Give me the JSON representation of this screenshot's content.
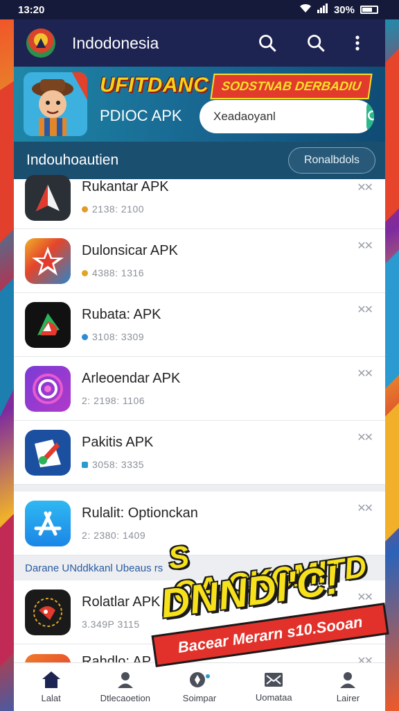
{
  "status_bar": {
    "time": "13:20",
    "battery": "30%"
  },
  "app_bar": {
    "title": "Indodonesia",
    "icons": [
      "search-icon",
      "search-icon",
      "more-vert-icon"
    ]
  },
  "banner": {
    "title": "UFITDANC",
    "tag": "SODSTNAB DERBADIU",
    "subtitle": "PDIOC APK",
    "search_value": "Xeadaoyanl"
  },
  "section": {
    "title": "Indouhoautien",
    "button": "Ronalbdols"
  },
  "list": [
    {
      "name": "Rukantar APK",
      "meta": "2138: 2100",
      "dot": "#e39a2a"
    },
    {
      "name": "Dulonsicar APK",
      "meta": "4388: 1316",
      "dot": "#e0a524"
    },
    {
      "name": "Rubata: APK",
      "meta": "3108: 3309",
      "dot": "#2c8bd6"
    },
    {
      "name": "Arleoendar APK",
      "meta": "2: 2198: 1106",
      "dot": ""
    },
    {
      "name": "Pakitis APK",
      "meta": "3058: 3335",
      "dot": "#2a9ad0"
    },
    {
      "name": "Rulalit: Optionckan",
      "meta": "2: 2380: 1409",
      "dot": ""
    },
    {
      "name": "Rolatlar APK",
      "meta": "3.349P 3115",
      "dot": ""
    },
    {
      "name": "Rahdlo: AP",
      "meta": "",
      "dot": ""
    }
  ],
  "sub_caption": "Darane UNddkkanl Ubeaus rs",
  "promo": {
    "line1": "S OA.CKCMITD",
    "line2": "DNNDI'C!",
    "ribbon": "Bacear Merarn s10.Sooan"
  },
  "bottom_nav": [
    {
      "label": "Lalat",
      "icon": "home-icon"
    },
    {
      "label": "Dtlecaoetion",
      "icon": "person-icon"
    },
    {
      "label": "Soimpar",
      "icon": "compass-icon"
    },
    {
      "label": "Uomataa",
      "icon": "mail-icon"
    },
    {
      "label": "Lairer",
      "icon": "person-icon"
    }
  ],
  "colors": {
    "appbar": "#1e2452",
    "banner": "#17648f",
    "accent": "#2bb98a",
    "section": "#1b4f70"
  }
}
